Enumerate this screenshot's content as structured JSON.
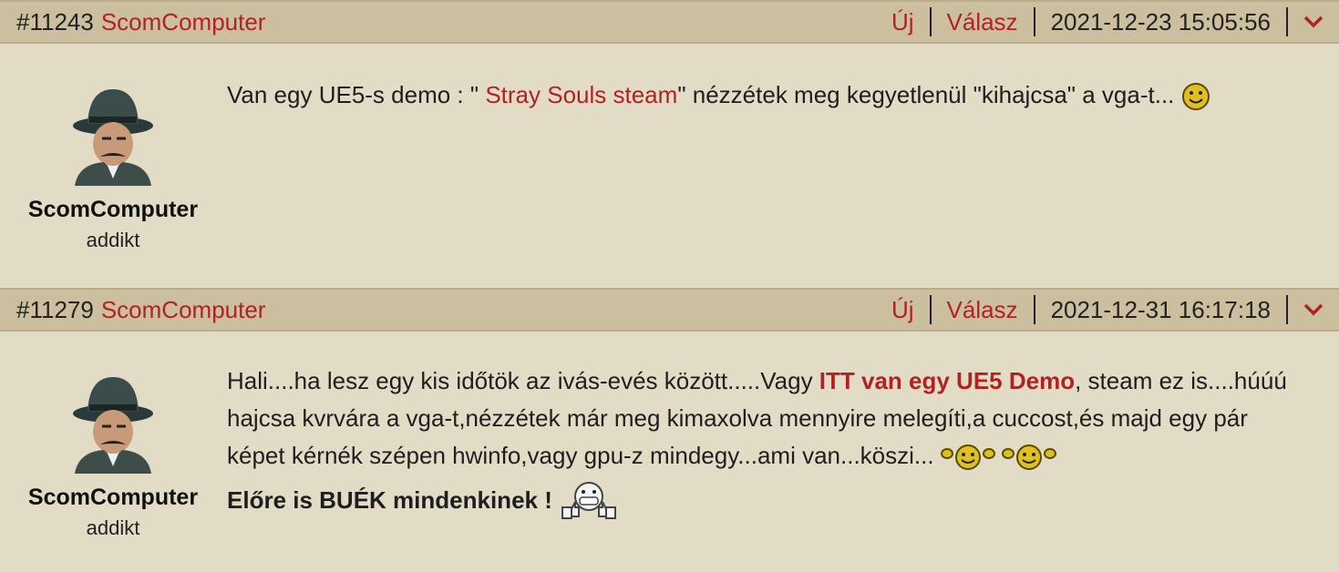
{
  "posts": [
    {
      "number": "#11243",
      "author": "ScomComputer",
      "new_label": "Új",
      "reply_label": "Válasz",
      "datetime": "2021-12-23 15:05:56",
      "username": "ScomComputer",
      "rank": "addikt",
      "text_before": "Van egy UE5-s demo : \"",
      "link_text": " Stray Souls steam",
      "text_after": "\" nézzétek meg kegyetlenül \"kihajcsa\" a vga-t..."
    },
    {
      "number": "#11279",
      "author": "ScomComputer",
      "new_label": "Új",
      "reply_label": "Válasz",
      "datetime": "2021-12-31 16:17:18",
      "username": "ScomComputer",
      "rank": "addikt",
      "text_before": "Hali....ha lesz egy kis időtök az ivás-evés között.....Vagy ",
      "link_text": "ITT van egy UE5 Demo",
      "text_after": ", steam ez is....húúú hajcsa kvrvára a vga-t,nézzétek már meg kimaxolva mennyire melegíti,a cuccost,és majd egy pár képet kérnék szépen hwinfo,vagy gpu-z mindegy...ami van...köszi...",
      "bold_line": "Előre is BUÉK mindenkinek !"
    }
  ],
  "icons": {
    "avatar": "detective-avatar-icon",
    "menu": "chevron-down-icon",
    "smiley": "smiley-icon",
    "wave_smiley": "waving-smiley-icon",
    "thumbs_smiley": "thumbs-up-grin-icon"
  },
  "colors": {
    "accent": "#b22222",
    "header_bg": "#cbbf9f",
    "body_bg": "#e2dcc6"
  }
}
